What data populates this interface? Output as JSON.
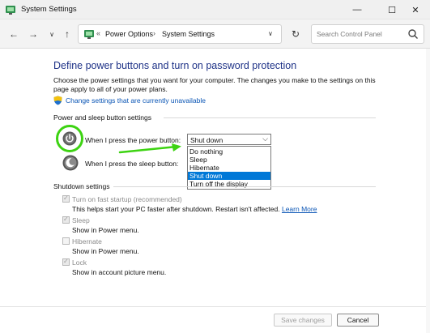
{
  "window": {
    "title": "System Settings",
    "min_glyph": "—",
    "max_glyph": "☐",
    "close_glyph": "✕"
  },
  "nav": {
    "back_glyph": "←",
    "forward_glyph": "→",
    "recent_glyph": "∨",
    "up_glyph": "↑"
  },
  "address": {
    "separator0": "«",
    "crumb1": "Power Options",
    "separator1": "›",
    "crumb2": "System Settings",
    "dropdown_glyph": "∨",
    "refresh_glyph": "↻"
  },
  "search": {
    "placeholder": "Search Control Panel"
  },
  "page": {
    "title": "Define power buttons and turn on password protection",
    "description": "Choose the power settings that you want for your computer. The changes you make to the settings on this page apply to all of your power plans.",
    "change_link": "Change settings that are currently unavailable"
  },
  "power_group": {
    "label": "Power and sleep button settings",
    "power_button_label": "When I press the power button:",
    "sleep_button_label": "When I press the sleep button:",
    "power_select": {
      "value": "Shut down",
      "arrow": "⌵",
      "options": [
        "Do nothing",
        "Sleep",
        "Hibernate",
        "Shut down",
        "Turn off the display"
      ],
      "highlighted": "Shut down"
    }
  },
  "shutdown_group": {
    "label": "Shutdown settings",
    "items": [
      {
        "label": "Turn on fast startup (recommended)",
        "desc": "This helps start your PC faster after shutdown. Restart isn't affected.",
        "link": "Learn More",
        "checked": true
      },
      {
        "label": "Sleep",
        "desc": "Show in Power menu.",
        "checked": true
      },
      {
        "label": "Hibernate",
        "desc": "Show in Power menu.",
        "checked": false
      },
      {
        "label": "Lock",
        "desc": "Show in account picture menu.",
        "checked": true
      }
    ],
    "check_glyph": "✓"
  },
  "footer": {
    "save_label": "Save changes",
    "cancel_label": "Cancel"
  },
  "colors": {
    "title_blue": "#1e3287",
    "link_blue": "#0a55b5",
    "highlight_green": "#3dd312",
    "selection_blue": "#0078d7"
  }
}
